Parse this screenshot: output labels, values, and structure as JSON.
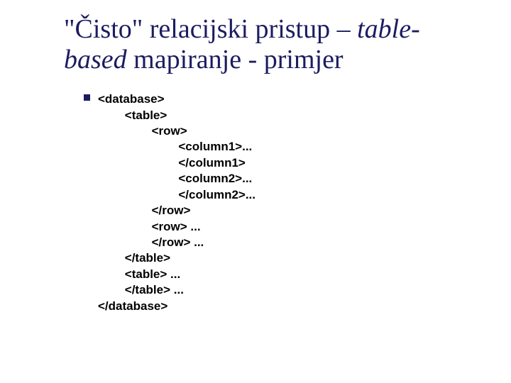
{
  "title": {
    "part1": "\"Čisto\" relacijski pristup – ",
    "italic1": "table-",
    "italic2": "based",
    "part2": " mapiranje - primjer"
  },
  "code": {
    "l01": "<database>",
    "l02": "        <table>",
    "l03": "                <row>",
    "l04": "                        <column1>...",
    "l05": "                        </column1>",
    "l06": "                        <column2>...",
    "l07": "                        </column2>...",
    "l08": "                </row>",
    "l09": "                <row> ...",
    "l10": "                </row> ...",
    "l11": "        </table>",
    "l12": "        <table> ...",
    "l13": "        </table> ...",
    "l14": "</database>"
  }
}
